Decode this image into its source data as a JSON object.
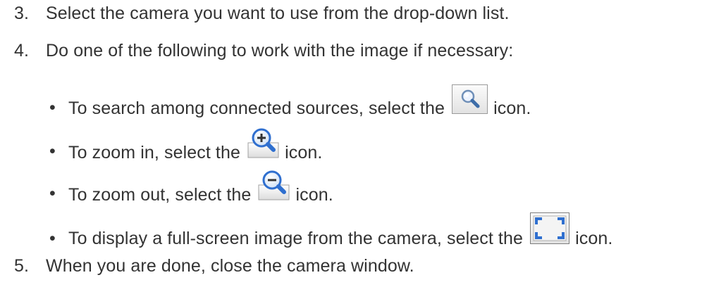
{
  "steps": [
    {
      "number": "3.",
      "text": "Select the camera you want to use from the drop-down list."
    },
    {
      "number": "4.",
      "text": "Do one of the following to work with the image if necessary:"
    },
    {
      "number": "5.",
      "text": "When you are done, close the camera window."
    }
  ],
  "bullets": [
    {
      "marker": "•",
      "before": "To search among connected sources, select the",
      "after": "icon.",
      "icon": "search-icon"
    },
    {
      "marker": "•",
      "before": "To zoom in, select the",
      "after": "icon.",
      "icon": "zoom-in-icon"
    },
    {
      "marker": "•",
      "before": "To zoom out, select the",
      "after": "icon.",
      "icon": "zoom-out-icon"
    },
    {
      "marker": "•",
      "before": "To display a full-screen image from the camera, select the",
      "after": "icon.",
      "icon": "full-screen-icon"
    }
  ],
  "colors": {
    "text": "#333333",
    "icon_blue": "#2f6fcf",
    "icon_border": "#9a9a9a"
  }
}
